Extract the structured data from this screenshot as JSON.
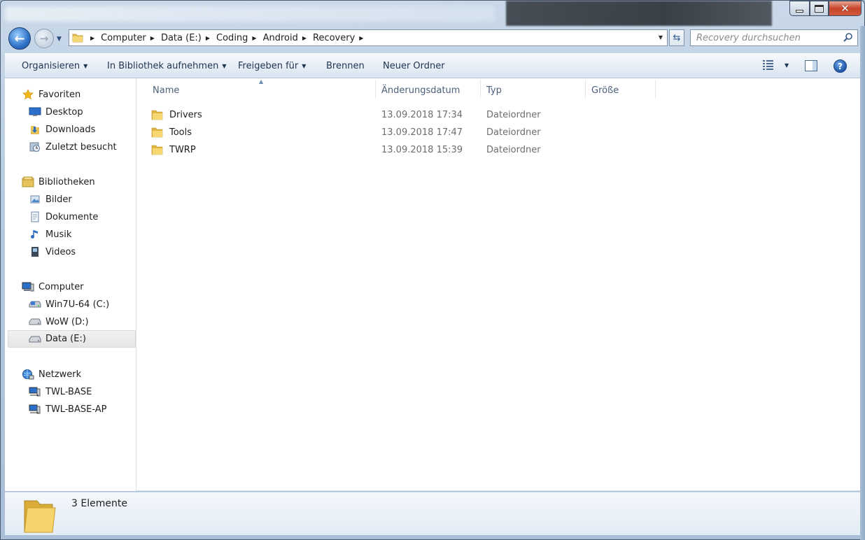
{
  "window": {
    "title_blurred": "",
    "controls": [
      "minimize",
      "maximize",
      "close"
    ]
  },
  "navigation": {
    "breadcrumb": [
      "Computer",
      "Data (E:)",
      "Coding",
      "Android",
      "Recovery"
    ],
    "search_placeholder": "Recovery durchsuchen"
  },
  "commandbar": {
    "organize": "Organisieren",
    "include_library": "In Bibliothek aufnehmen",
    "share": "Freigeben für",
    "burn": "Brennen",
    "new_folder": "Neuer Ordner"
  },
  "sidebar": {
    "favorites": {
      "title": "Favoriten",
      "items": [
        "Desktop",
        "Downloads",
        "Zuletzt besucht"
      ]
    },
    "libraries": {
      "title": "Bibliotheken",
      "items": [
        "Bilder",
        "Dokumente",
        "Musik",
        "Videos"
      ]
    },
    "computer": {
      "title": "Computer",
      "items": [
        "Win7U-64 (C:)",
        "WoW (D:)",
        "Data (E:)"
      ],
      "selected": "Data (E:)"
    },
    "network": {
      "title": "Netzwerk",
      "items": [
        "TWL-BASE",
        "TWL-BASE-AP"
      ]
    }
  },
  "columns": {
    "name": "Name",
    "date": "Änderungsdatum",
    "type": "Typ",
    "size": "Größe"
  },
  "files": [
    {
      "name": "Drivers",
      "date": "13.09.2018 17:34",
      "type": "Dateiordner"
    },
    {
      "name": "Tools",
      "date": "13.09.2018 17:47",
      "type": "Dateiordner"
    },
    {
      "name": "TWRP",
      "date": "13.09.2018 15:39",
      "type": "Dateiordner"
    }
  ],
  "status": {
    "count": "3 Elemente"
  },
  "colors": {
    "accent": "#2e72c8",
    "folder": "#f2cd5c",
    "selected_bg": "#e5e5e5"
  }
}
